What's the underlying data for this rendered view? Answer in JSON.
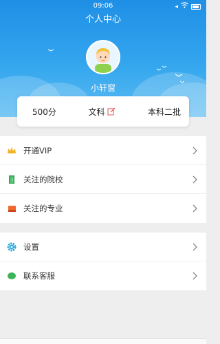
{
  "status_bar": {
    "time": "09:06"
  },
  "header": {
    "title": "个人中心",
    "username": "小轩窗"
  },
  "info_card": {
    "score": "500分",
    "subject": "文科",
    "batch": "本科二批"
  },
  "menu_group1": [
    {
      "label": "开通VIP",
      "icon": "crown-icon",
      "color": "#f0b429"
    },
    {
      "label": "关注的院校",
      "icon": "door-icon",
      "color": "#2e9e4f"
    },
    {
      "label": "关注的专业",
      "icon": "book-icon",
      "color": "#f06a2f"
    }
  ],
  "menu_group2": [
    {
      "label": "设置",
      "icon": "gear-icon",
      "color": "#2aa6d9"
    },
    {
      "label": "联系客服",
      "icon": "chat-icon",
      "color": "#3cb55a"
    }
  ],
  "colors": {
    "header_top": "#1f8fe6",
    "header_bottom": "#5cbcf2",
    "edit_icon": "#e05050"
  }
}
